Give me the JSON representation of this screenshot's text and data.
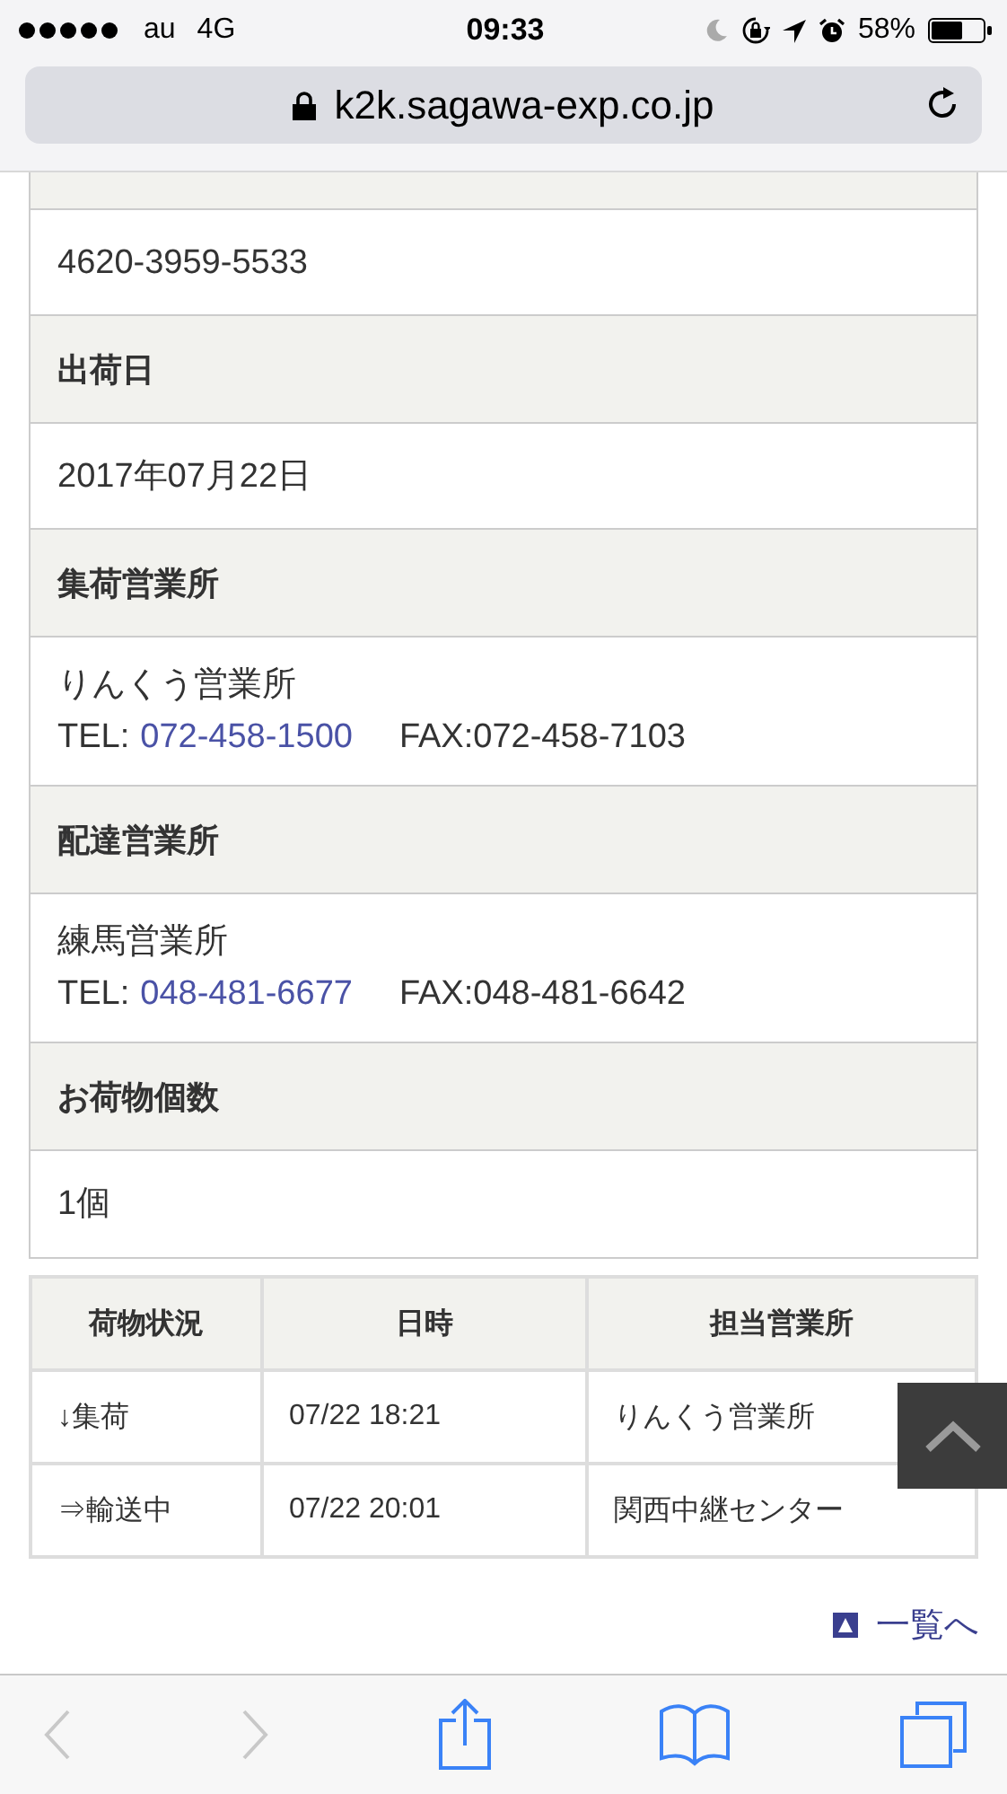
{
  "status_bar": {
    "carrier": "au",
    "network": "4G",
    "time": "09:33",
    "battery": "58%"
  },
  "address_bar": {
    "url": "k2k.sagawa-exp.co.jp"
  },
  "info": [
    {
      "value": "4620-3959-5533"
    },
    {
      "label": "出荷日",
      "value": "2017年07月22日"
    },
    {
      "label": "集荷営業所",
      "value": "りんくう営業所",
      "tel_label": "TEL:",
      "tel": "072-458-1500",
      "fax": "FAX:072-458-7103"
    },
    {
      "label": "配達営業所",
      "value": "練馬営業所",
      "tel_label": "TEL:",
      "tel": "048-481-6677",
      "fax": "FAX:048-481-6642"
    },
    {
      "label": "お荷物個数",
      "value": "1個"
    }
  ],
  "table": {
    "columns": [
      "荷物状況",
      "日時",
      "担当営業所"
    ],
    "rows": [
      [
        "↓集荷",
        "07/22 18:21",
        "りんくう営業所"
      ],
      [
        "⇒輸送中",
        "07/22 20:01",
        "関西中継センター"
      ]
    ]
  },
  "list_link": "一覧へ",
  "toolbar": [
    {
      "kind": "back",
      "disabled": true
    },
    {
      "kind": "forward",
      "disabled": true
    },
    {
      "kind": "share",
      "disabled": false
    },
    {
      "kind": "bookmarks",
      "disabled": false
    },
    {
      "kind": "tabs",
      "disabled": false
    }
  ]
}
